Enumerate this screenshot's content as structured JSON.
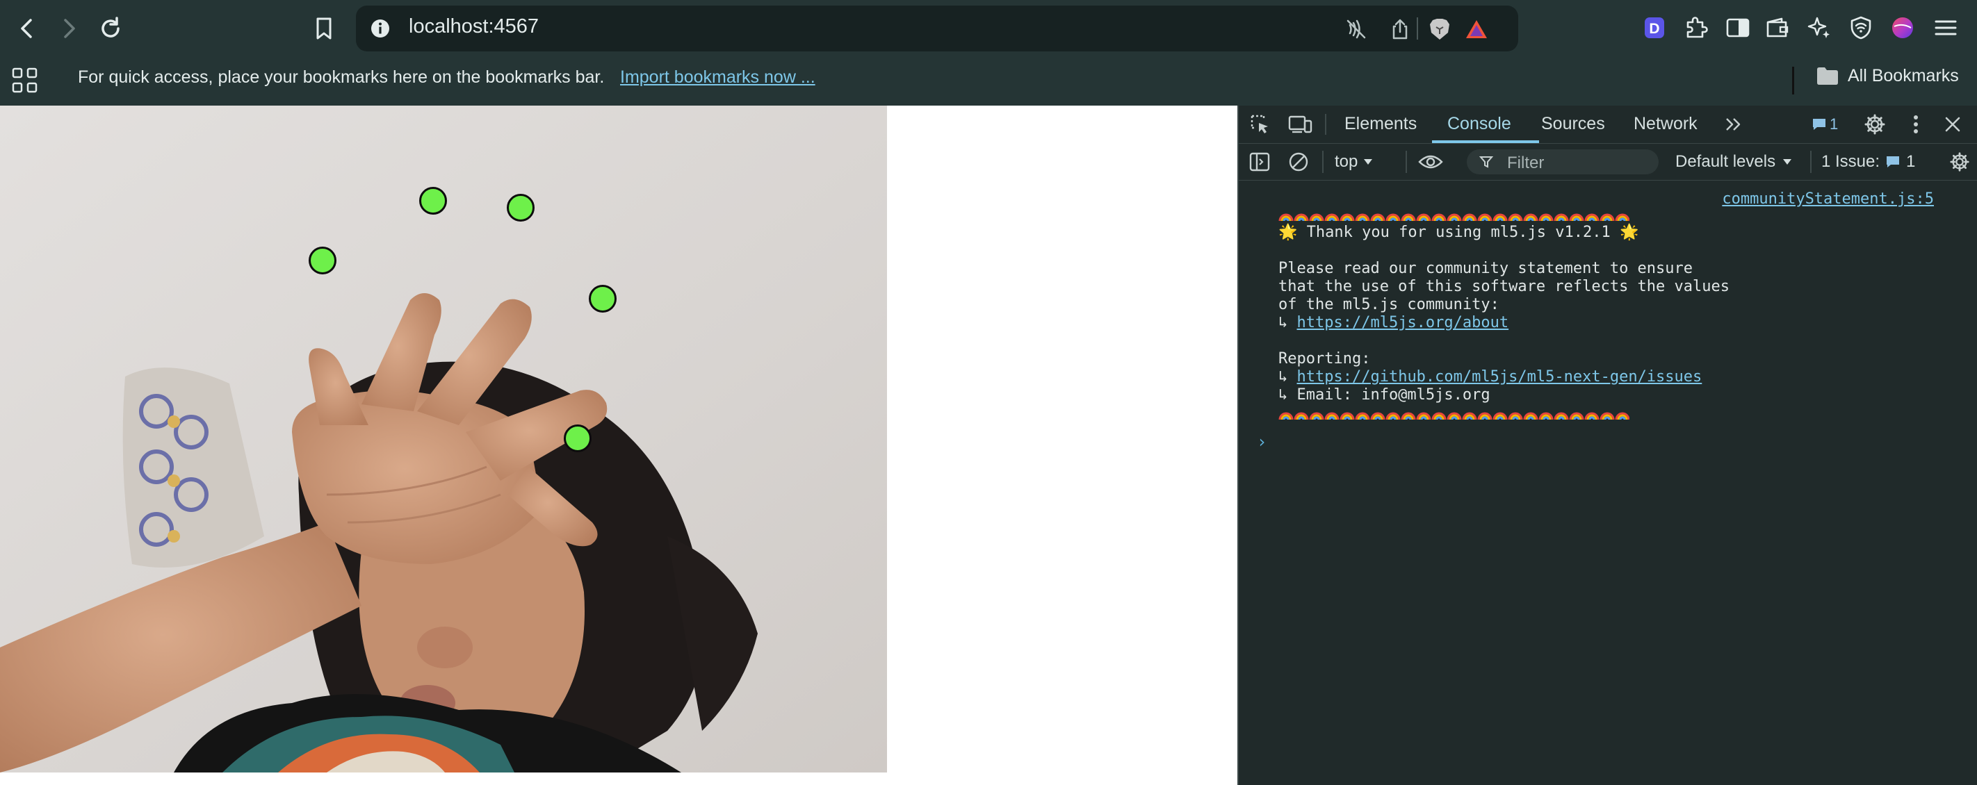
{
  "browser": {
    "url": "localhost:4567",
    "bookmarks_bar": {
      "message": "For quick access, place your bookmarks here on the bookmarks bar.",
      "import_link": "Import bookmarks now ...",
      "all_bookmarks": "All Bookmarks"
    },
    "extensions": [
      "d-extension-icon",
      "puzzle-icon",
      "sidebar-icon",
      "wallet-icon",
      "leo-ai-icon",
      "vpn-shield-icon",
      "profile-avatar",
      "menu-icon"
    ]
  },
  "page": {
    "keypoints": [
      {
        "name": "thumb-tip"
      },
      {
        "name": "index-tip"
      },
      {
        "name": "middle-tip"
      },
      {
        "name": "ring-tip"
      },
      {
        "name": "pinky-tip"
      }
    ],
    "keypoint_color": "#6ef04a"
  },
  "devtools": {
    "tabs": [
      "Elements",
      "Console",
      "Sources",
      "Network"
    ],
    "active_tab": "Console",
    "messages_badge": "1",
    "context": "top",
    "filter_placeholder": "Filter",
    "levels": "Default levels",
    "issues_label": "1 Issue:",
    "issues_count": "1",
    "console": {
      "source": "communityStatement.js:5",
      "thank_you": "🌟 Thank you for using ml5.js v1.2.1 🌟",
      "statement_1": "Please read our community statement to ensure",
      "statement_2": "that the use of this software reflects the values",
      "statement_3": "of the ml5.js community:",
      "arrow": "↳ ",
      "about_link": "https://ml5js.org/about",
      "reporting": "Reporting:",
      "issues_link": "https://github.com/ml5js/ml5-next-gen/issues",
      "email": "↳ Email: info@ml5js.org",
      "prompt": "›"
    }
  }
}
